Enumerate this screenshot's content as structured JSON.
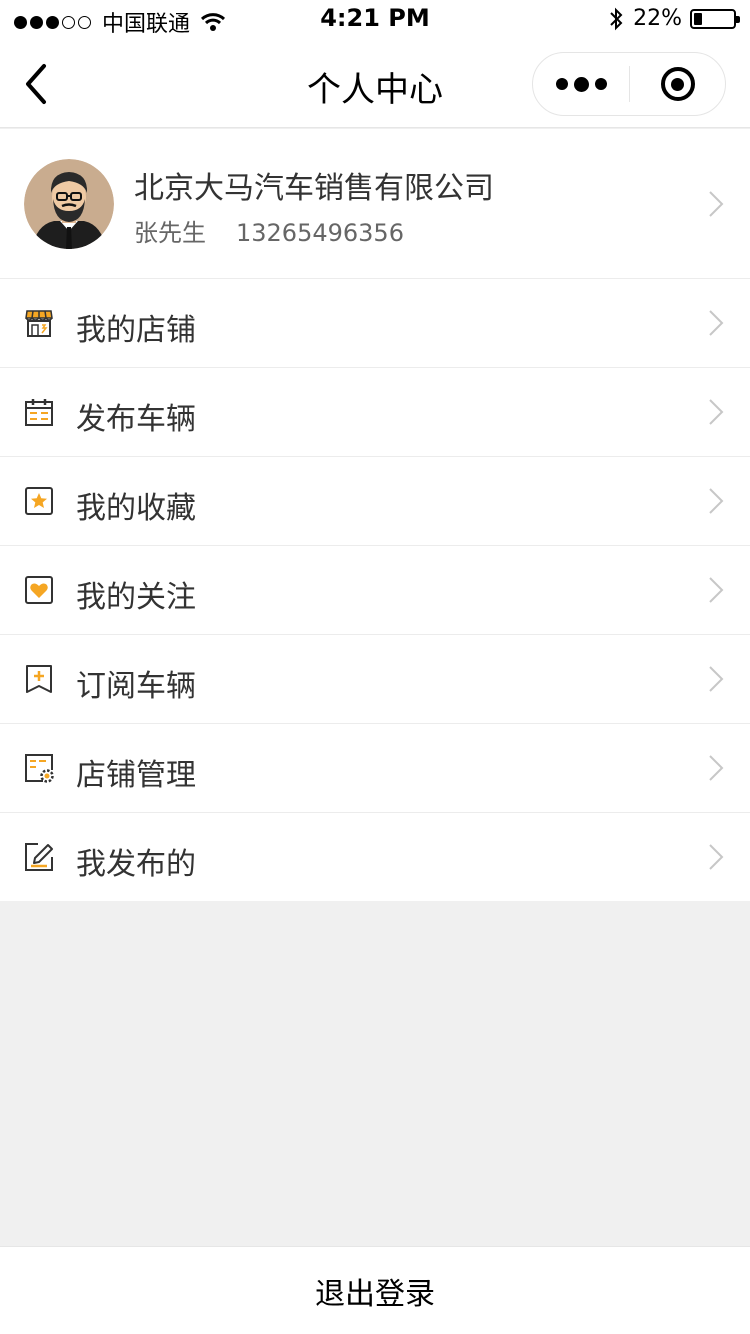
{
  "status_bar": {
    "carrier": "中国联通",
    "time": "4:21 PM",
    "battery_text": "22%",
    "battery_level": 0.22,
    "icons": [
      "signal-dots-icon",
      "wifi-icon",
      "bluetooth-icon",
      "battery-icon"
    ]
  },
  "nav": {
    "title": "个人中心",
    "icons": [
      "back-arrow-icon",
      "more-dots-icon",
      "close-ring-icon"
    ]
  },
  "profile": {
    "company": "北京大马汽车销售有限公司",
    "name": "张先生",
    "phone": "13265496356",
    "avatar": "bearded-man-avatar"
  },
  "menu": {
    "items": [
      {
        "label": "我的店铺",
        "icon": "store-icon"
      },
      {
        "label": "发布车辆",
        "icon": "calendar-icon"
      },
      {
        "label": "我的收藏",
        "icon": "star-icon"
      },
      {
        "label": "我的关注",
        "icon": "heart-icon"
      },
      {
        "label": "订阅车辆",
        "icon": "subscribe-plus-icon"
      },
      {
        "label": "店铺管理",
        "icon": "store-settings-icon"
      },
      {
        "label": "我发布的",
        "icon": "edit-icon"
      }
    ]
  },
  "logout": {
    "label": "退出登录"
  },
  "colors": {
    "accent": "#f5a623",
    "text": "#333333",
    "subtext": "#666666",
    "background": "#f0f0f0"
  }
}
